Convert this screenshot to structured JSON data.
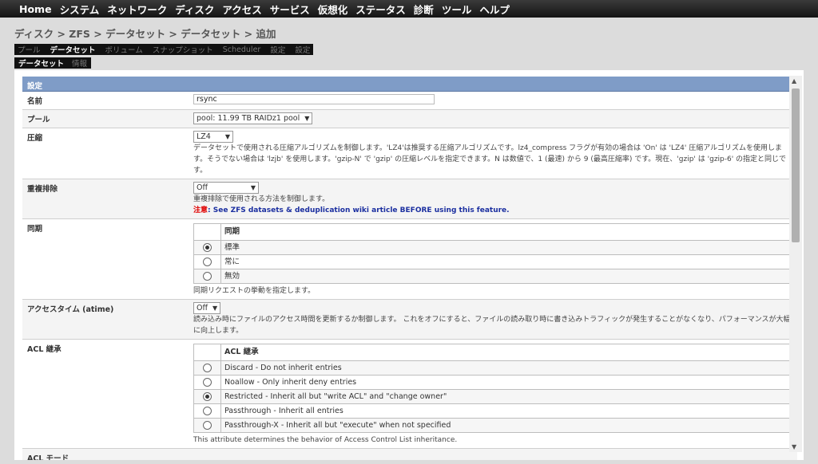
{
  "nav": [
    "Home",
    "システム",
    "ネットワーク",
    "ディスク",
    "アクセス",
    "サービス",
    "仮想化",
    "ステータス",
    "診断",
    "ツール",
    "ヘルプ"
  ],
  "breadcrumb": "ディスク > ZFS > データセット > データセット > 追加",
  "tabs_main": [
    "プール",
    "データセット",
    "ボリューム",
    "スナップショット",
    "Scheduler",
    "設定",
    "設定"
  ],
  "tabs_sub": [
    "データセット",
    "情報"
  ],
  "section_title": "設定",
  "name": {
    "label": "名前",
    "value": "rsync"
  },
  "pool": {
    "label": "プール",
    "value": "pool: 11.99 TB RAIDz1 pool"
  },
  "compression": {
    "label": "圧縮",
    "value": "LZ4",
    "desc": "データセットで使用される圧縮アルゴリズムを制御します。'LZ4'は推奨する圧縮アルゴリズムです。lz4_compress フラグが有効の場合は 'On' は 'LZ4' 圧縮アルゴリズムを使用します。そうでない場合は 'lzjb' を使用します。'gzip-N' で 'gzip' の圧縮レベルを指定できます。N は数値で、1 (最速) から 9 (最高圧縮率) です。現在、'gzip' は 'gzip-6' の指定と同じです。"
  },
  "dedup": {
    "label": "重複排除",
    "value": "Off",
    "desc": "重複排除で使用される方法を制御します。",
    "note_label": "注意",
    "note_text": ": See ZFS datasets & deduplication wiki article BEFORE using this feature."
  },
  "sync": {
    "label": "同期",
    "header": "同期",
    "options": [
      "標準",
      "常に",
      "無効"
    ],
    "selected": 0,
    "desc": "同期リクエストの挙動を指定します。"
  },
  "atime": {
    "label": "アクセスタイム (atime)",
    "value": "Off",
    "desc": "読み込み時にファイルのアクセス時間を更新するか制御します。 これをオフにすると、ファイルの読み取り時に書き込みトラフィックが発生することがなくなり、パフォーマンスが大幅に向上します。"
  },
  "aclinherit": {
    "label": "ACL 継承",
    "header": "ACL 継承",
    "options": [
      "Discard - Do not inherit entries",
      "Noallow - Only inherit deny entries",
      "Restricted - Inherit all but \"write ACL\" and \"change owner\"",
      "Passthrough - Inherit all entries",
      "Passthrough-X - Inherit all but \"execute\" when not specified"
    ],
    "selected": 2,
    "desc": "This attribute determines the behavior of Access Control List inheritance."
  },
  "aclmode": {
    "label": "ACL モード"
  }
}
